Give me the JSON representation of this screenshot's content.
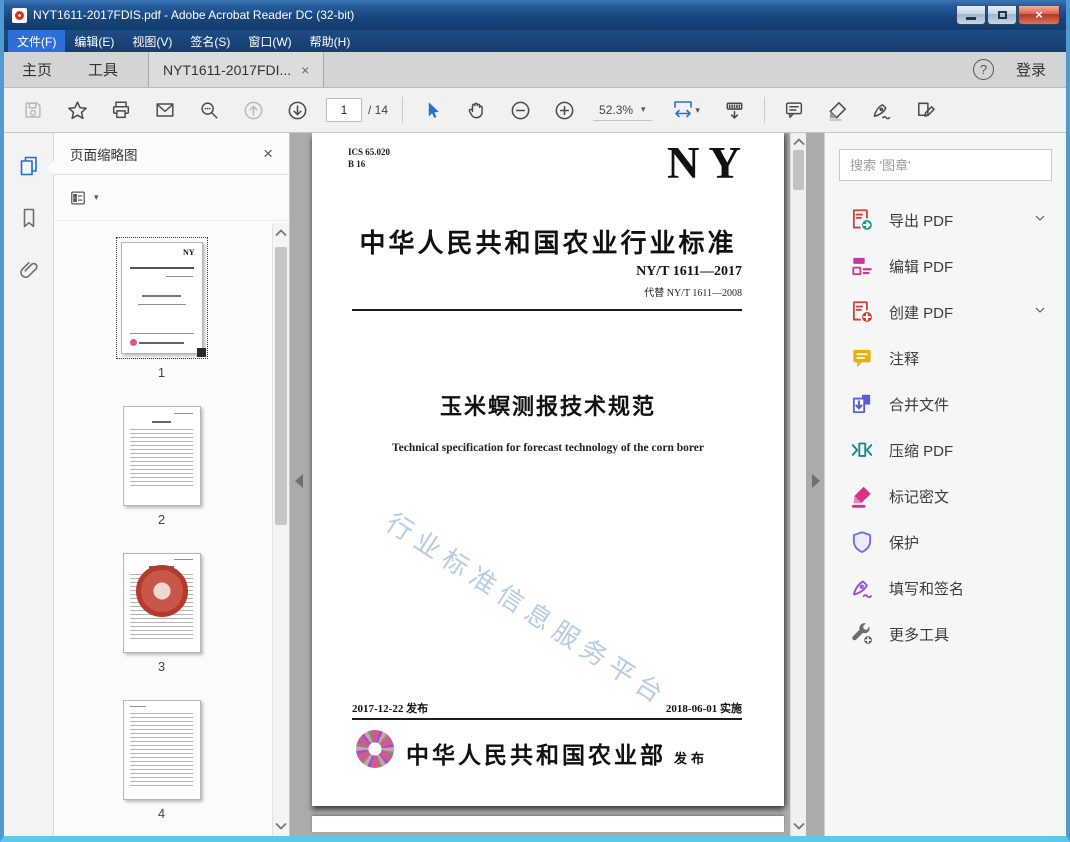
{
  "window": {
    "title": "NYT1611-2017FDIS.pdf - Adobe Acrobat Reader DC (32-bit)"
  },
  "menu_bar": {
    "items": [
      {
        "label": "文件(F)"
      },
      {
        "label": "编辑(E)"
      },
      {
        "label": "视图(V)"
      },
      {
        "label": "签名(S)"
      },
      {
        "label": "窗口(W)"
      },
      {
        "label": "帮助(H)"
      }
    ]
  },
  "tab_bar": {
    "home": "主页",
    "tools": "工具",
    "document_tab": "NYT1611-2017FDI...",
    "close": "×",
    "sign_in": "登录",
    "help": "?"
  },
  "toolbar": {
    "current_page": "1",
    "page_count": "/ 14",
    "zoom_level": "52.3%"
  },
  "thumbnails_panel": {
    "title": "页面缩略图",
    "close": "×",
    "pages": [
      {
        "number": "1"
      },
      {
        "number": "2"
      },
      {
        "number": "3"
      },
      {
        "number": "4"
      }
    ]
  },
  "document_page": {
    "ics": "ICS 65.020",
    "classification": "B 16",
    "logo": "NY",
    "standard_heading": "中华人民共和国农业行业标准",
    "standard_number": "NY/T 1611—2017",
    "replaces": "代替 NY/T 1611—2008",
    "title_cn": "玉米螟测报技术规范",
    "title_en": "Technical specification for forecast technology of the corn borer",
    "watermark": "行业标准信息服务平台",
    "issue_date": "2017-12-22 发布",
    "implementation_date": "2018-06-01 实施",
    "publisher": "中华人民共和国农业部",
    "publish_label": "发布"
  },
  "tools_panel": {
    "search_placeholder": "搜索 '图章'",
    "tools": [
      {
        "label": "导出 PDF",
        "chevron": true
      },
      {
        "label": "编辑 PDF"
      },
      {
        "label": "创建 PDF",
        "chevron": true
      },
      {
        "label": "注释"
      },
      {
        "label": "合并文件"
      },
      {
        "label": "压缩 PDF"
      },
      {
        "label": "标记密文"
      },
      {
        "label": "保护"
      },
      {
        "label": "填写和签名"
      },
      {
        "label": "更多工具"
      }
    ]
  },
  "colors": {
    "accent_blue": "#2273cc",
    "acrobat_red": "#c9453f",
    "export_teal": "#17a08e",
    "edit_magenta": "#c2399e",
    "comment_yellow": "#e7b10a",
    "combine_blue": "#5b5ed8",
    "compress_teal": "#108a88",
    "redact_pink": "#d63384",
    "protect_indigo": "#6b6de0",
    "sign_purple": "#9a4fd8"
  }
}
